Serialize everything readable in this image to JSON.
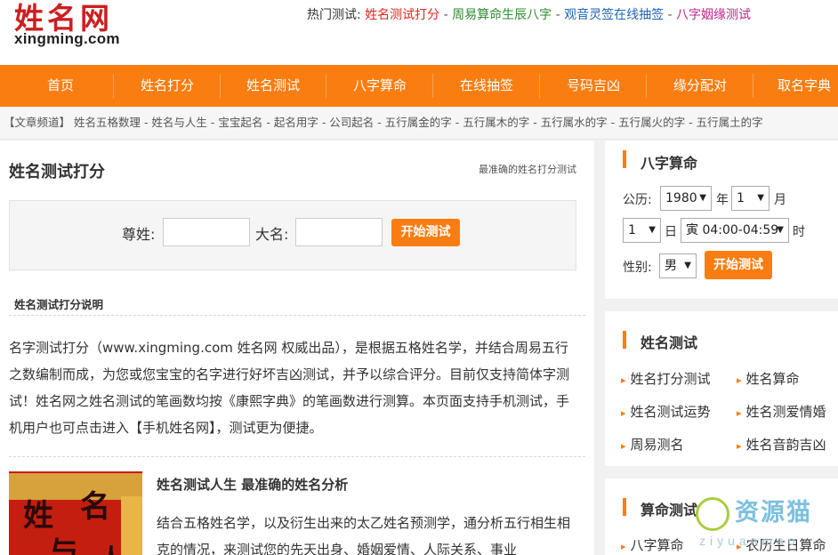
{
  "header": {
    "logo_cn": "姓名网",
    "logo_en": "xingming.com",
    "hot_label": "热门测试:",
    "hot_links": [
      "姓名测试打分",
      "周易算命生辰八字",
      "观音灵签在线抽签",
      "八字姻缘测试"
    ],
    "hot_sep": " - "
  },
  "nav": {
    "items": [
      "首页",
      "姓名打分",
      "姓名测试",
      "八字算命",
      "在线抽签",
      "号码吉凶",
      "缘分配对",
      "取名字典"
    ]
  },
  "channels": {
    "text": "【文章频道】 姓名五格数理 - 姓名与人生 - 宝宝起名 - 起名用字 - 公司起名 - 五行属金的字 - 五行属木的字 - 五行属水的字 - 五行属火的字 - 五行属土的字"
  },
  "main": {
    "title": "姓名测试打分",
    "subtitle": "最准确的姓名打分测试",
    "form": {
      "surname_label": "尊姓:",
      "name_label": "大名:",
      "surname_value": "",
      "name_value": "",
      "submit_label": "开始测试"
    },
    "section_heading": "姓名测试打分说明",
    "intro": "名字测试打分（www.xingming.com 姓名网 权威出品），是根据五格姓名学，并结合周易五行之数编制而成，为您或您宝宝的名字进行好坏吉凶测试，并予以综合评分。目前仅支持简体字测试！姓名网之姓名测试的笔画数均按《康熙字典》的笔画数进行测算。本页面支持手机测试，手机用户也可点击进入【手机姓名网】，测试更为便捷。",
    "article": {
      "image_text": [
        "姓",
        "名",
        "与",
        "人"
      ],
      "title": "姓名测试人生 最准确的姓名分析",
      "text": "结合五格姓名学，以及衍生出来的太乙姓名预测学，通分析五行相生相克的情况，来测试您的先天出身、婚姻爱情、人际关系、事业"
    }
  },
  "bazi": {
    "title": "八字算命",
    "calendar_label": "公历:",
    "year": "1980",
    "year_unit": "年",
    "month": "1",
    "month_unit": "月",
    "day": "1",
    "day_unit": "日",
    "hour": "寅 04:00-04:59",
    "hour_unit": "时",
    "gender_label": "性别:",
    "gender": "男",
    "submit_label": "开始测试"
  },
  "name_test": {
    "title": "姓名测试",
    "links": [
      "姓名打分测试",
      "姓名算命",
      "姓名测试运势",
      "姓名测爱情婚",
      "周易测名",
      "姓名音韵吉凶"
    ]
  },
  "fortune": {
    "title": "算命测试",
    "links": [
      "八字算命",
      "农历生日算命"
    ]
  },
  "watermark": {
    "cn": "资源猫",
    "en": "ziyuanmao"
  },
  "colors": {
    "accent": "#fa7d11",
    "logo_red": "#cc1f1f",
    "hot_red": "#e4251e",
    "hot_green": "#2f8a2f",
    "hot_blue": "#1e64b4",
    "hot_magenta": "#c2238c"
  }
}
